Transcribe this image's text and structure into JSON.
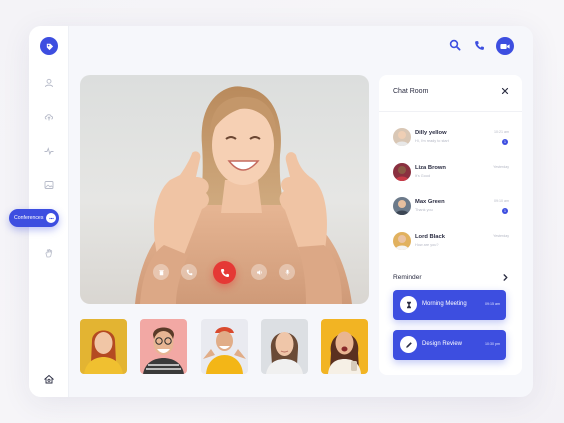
{
  "colors": {
    "accent": "#3d4ee0",
    "end_call": "#e53935",
    "text": "#2b2d42",
    "muted": "#b5b8c5"
  },
  "sidebar": {
    "logo_icon": "tag-icon",
    "items": [
      {
        "icon": "user-icon"
      },
      {
        "icon": "cloud-upload-icon"
      },
      {
        "icon": "activity-icon"
      },
      {
        "icon": "image-icon"
      },
      {
        "icon": "hand-icon"
      },
      {
        "icon": "settings-home-icon"
      }
    ],
    "active_label": "Conferences",
    "active_icon": "chat-bubble-icon"
  },
  "header": {
    "actions": [
      {
        "icon": "search-icon"
      },
      {
        "icon": "phone-icon"
      },
      {
        "icon": "video-camera-icon"
      }
    ]
  },
  "call_controls": [
    {
      "icon": "trash-icon"
    },
    {
      "icon": "phone-icon"
    },
    {
      "icon": "end-call-icon"
    },
    {
      "icon": "volume-icon"
    },
    {
      "icon": "microphone-icon"
    }
  ],
  "participants": [
    {
      "bg": "#e3b432",
      "shirt": "#f0c030"
    },
    {
      "bg": "#f2a8a4",
      "shirt": "#3a3a3a"
    },
    {
      "bg": "#e9eaf0",
      "shirt": "#f3b617"
    },
    {
      "bg": "#dcdfe3",
      "shirt": "#f0f0f0"
    },
    {
      "bg": "#f2b423",
      "shirt": "#f6f0e6"
    }
  ],
  "chat": {
    "title": "Chat Room",
    "close_icon": "close-icon",
    "contacts": [
      {
        "name": "Dilly yellow",
        "message": "Hi, I'm ready to start",
        "time": "10:21 am",
        "badge": "1",
        "avatar_bg": "#d9c7b5"
      },
      {
        "name": "Liza Brown",
        "message": "It's Good",
        "time": "Yesterday",
        "badge": "",
        "avatar_bg": "#8a3040"
      },
      {
        "name": "Max Green",
        "message": "Thank you",
        "time": "09:10 am",
        "badge": "1",
        "avatar_bg": "#6c7a8a"
      },
      {
        "name": "Lord Black",
        "message": "How are you?",
        "time": "Yesterday",
        "badge": "",
        "avatar_bg": "#e1b15e"
      }
    ]
  },
  "reminder": {
    "title": "Reminder",
    "arrow_icon": "chevron-right-icon",
    "items": [
      {
        "label": "Morning Meeting",
        "time": "09:15 am",
        "icon": "hourglass-icon"
      },
      {
        "label": "Design Review",
        "time": "10:30 pm",
        "icon": "pencil-icon"
      }
    ]
  }
}
